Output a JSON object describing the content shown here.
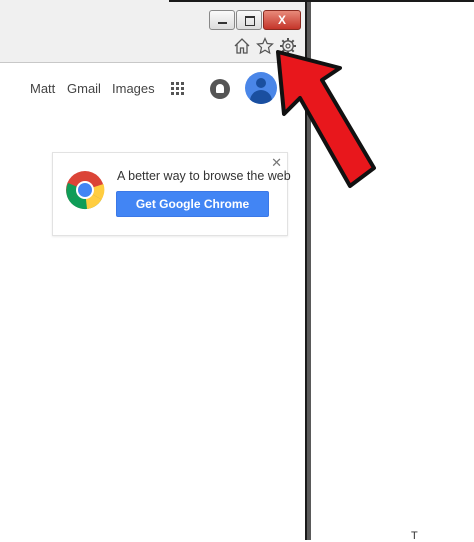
{
  "header": {
    "user_link": "Matt",
    "gmail_link": "Gmail",
    "images_link": "Images"
  },
  "toolbar": {
    "icons": [
      "home-icon",
      "star-icon",
      "gear-icon"
    ]
  },
  "window_controls": {
    "close_label": "X"
  },
  "promo": {
    "text": "A better way to browse the web",
    "button_label": "Get Google Chrome",
    "close_label": "✕"
  },
  "footer_mark": "T",
  "colors": {
    "accent_blue": "#4285f4",
    "arrow_red": "#e8171c",
    "close_red": "#c4352a"
  }
}
